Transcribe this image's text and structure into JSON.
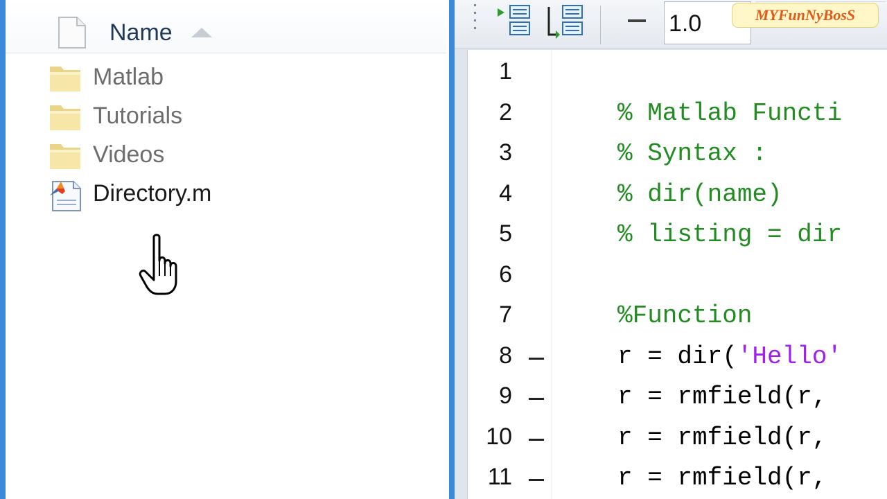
{
  "file_browser": {
    "column_header": {
      "name_label": "Name"
    },
    "items": [
      {
        "name": "Matlab",
        "type": "folder"
      },
      {
        "name": "Tutorials",
        "type": "folder"
      },
      {
        "name": "Videos",
        "type": "folder"
      },
      {
        "name": "Directory.m",
        "type": "m-file"
      }
    ],
    "icons": {
      "header": "file-icon",
      "folder": "folder-icon",
      "mfile": "matlab-file-icon",
      "cursor": "hand-pointer-icon"
    }
  },
  "editor": {
    "toolbar": {
      "cell_spacing_value": "1.0",
      "logo_text": "MYFunNyBosS",
      "icons": [
        "indent-icon",
        "unindent-icon",
        "minus-icon"
      ]
    },
    "lines": [
      {
        "num": "1",
        "code": "",
        "kind": "blank",
        "breakpoint": false
      },
      {
        "num": "2",
        "code": "% Matlab Functi",
        "kind": "comment",
        "breakpoint": false
      },
      {
        "num": "3",
        "code": "% Syntax :",
        "kind": "comment",
        "breakpoint": false
      },
      {
        "num": "4",
        "code": "% dir(name)",
        "kind": "comment",
        "breakpoint": false
      },
      {
        "num": "5",
        "code": "% listing = dir",
        "kind": "comment",
        "breakpoint": false
      },
      {
        "num": "6",
        "code": "",
        "kind": "blank",
        "breakpoint": false
      },
      {
        "num": "7",
        "code": "%Function",
        "kind": "comment",
        "breakpoint": false
      },
      {
        "num": "8",
        "code": "r = dir(",
        "string": "'Hello'",
        "kind": "code",
        "breakpoint": true
      },
      {
        "num": "9",
        "code": "r = rmfield(r,",
        "kind": "code",
        "breakpoint": true
      },
      {
        "num": "10",
        "code": "r = rmfield(r,",
        "kind": "code",
        "breakpoint": true
      },
      {
        "num": "11",
        "code": "r = rmfield(r,",
        "kind": "code",
        "breakpoint": true
      }
    ]
  },
  "colors": {
    "accent_blue": "#3b8ad9",
    "comment_green": "#228b22",
    "string_purple": "#a020f0",
    "logo_orange": "#e05b1a"
  }
}
